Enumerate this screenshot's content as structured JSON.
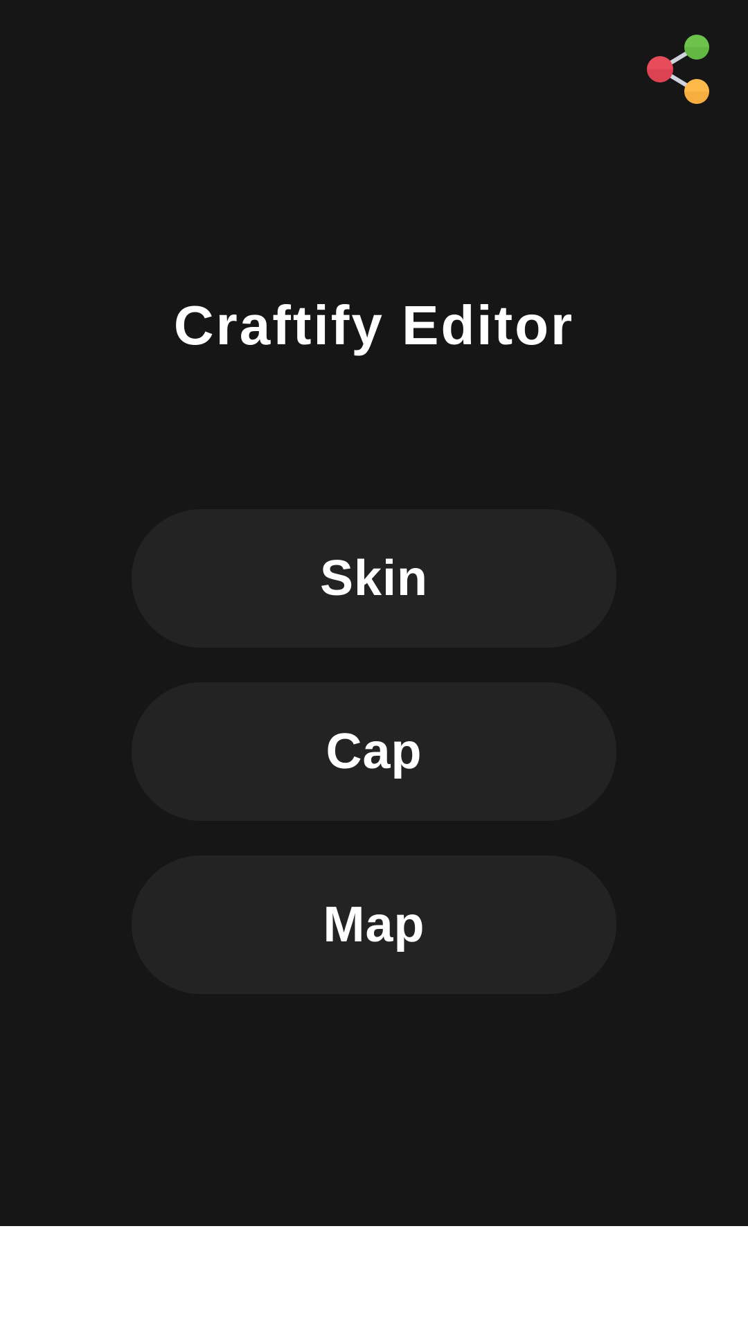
{
  "app": {
    "title": "Craftify Editor"
  },
  "header": {
    "share_icon": "share-icon",
    "share_colors": {
      "top": "#6cc24a",
      "left": "#e84c5b",
      "bottom": "#ffb94a",
      "connector": "#cfd3de"
    }
  },
  "menu": {
    "items": [
      {
        "label": "Skin"
      },
      {
        "label": "Cap"
      },
      {
        "label": "Map"
      }
    ]
  },
  "theme": {
    "background": "#161616",
    "button": "#232323",
    "text": "#ffffff"
  }
}
